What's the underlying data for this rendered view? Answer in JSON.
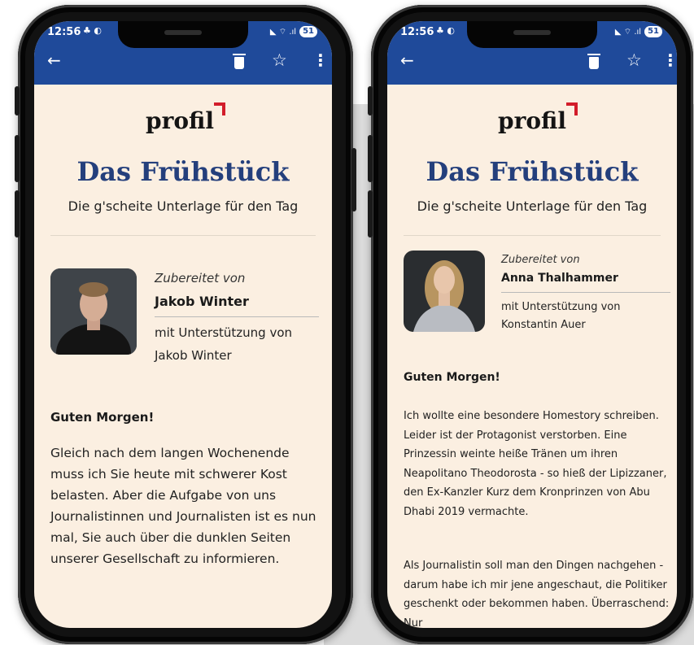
{
  "colors": {
    "app_bar": "#1f4a9a",
    "newsletter_background": "#fbefe1",
    "title": "#243f7c",
    "logo_accent": "#d21d2a"
  },
  "phones": [
    {
      "status": {
        "time": "12:56",
        "left_icons": "♣ ◐",
        "right_icons": "◣ ⌔ .ıl",
        "battery": "51"
      },
      "app_bar": {
        "back_icon": "←",
        "delete_icon": "trash-icon",
        "star_icon": "☆",
        "menu_icon": "⋮"
      },
      "logo": "profil",
      "title": "Das Frühstück",
      "subtitle": "Die g'scheite Unterlage für den Tag",
      "byline": {
        "label": "Zubereitet von",
        "author": "Jakob Winter",
        "assist_line1": "mit Unterstützung von",
        "assist_line2": "Jakob Winter"
      },
      "greeting": "Guten Morgen!",
      "paragraphs": [
        "Gleich nach dem langen Wochenende muss ich Sie heute mit schwerer Kost belasten. Aber die Aufgabe von uns Journalistinnen und Journalisten ist es nun mal, Sie auch über die dunklen Seiten unserer Gesellschaft zu informieren."
      ]
    },
    {
      "status": {
        "time": "12:56",
        "left_icons": "♣ ◐",
        "right_icons": "◣ ⌔ .ıl",
        "battery": "51"
      },
      "app_bar": {
        "back_icon": "←",
        "delete_icon": "trash-icon",
        "star_icon": "☆",
        "menu_icon": "⋮"
      },
      "logo": "profil",
      "title": "Das Frühstück",
      "subtitle": "Die g'scheite Unterlage für den Tag",
      "byline": {
        "label": "Zubereitet von",
        "author": "Anna Thalhammer",
        "assist_line1": "mit Unterstützung von",
        "assist_line2": "Konstantin Auer"
      },
      "greeting": "Guten Morgen!",
      "paragraphs": [
        "Ich wollte eine besondere Homestory schreiben. Leider ist der Protagonist verstorben. Eine Prinzessin weinte heiße Tränen um ihren Neapolitano Theodorosta - so hieß der Lipizzaner, den Ex-Kanzler Kurz dem Kronprinzen von Abu Dhabi 2019 vermachte.",
        "Als Journalistin soll man den Dingen nachgehen - darum habe ich mir jene angeschaut, die Politiker geschenkt oder bekommen haben. Überraschend: Nur"
      ]
    }
  ]
}
